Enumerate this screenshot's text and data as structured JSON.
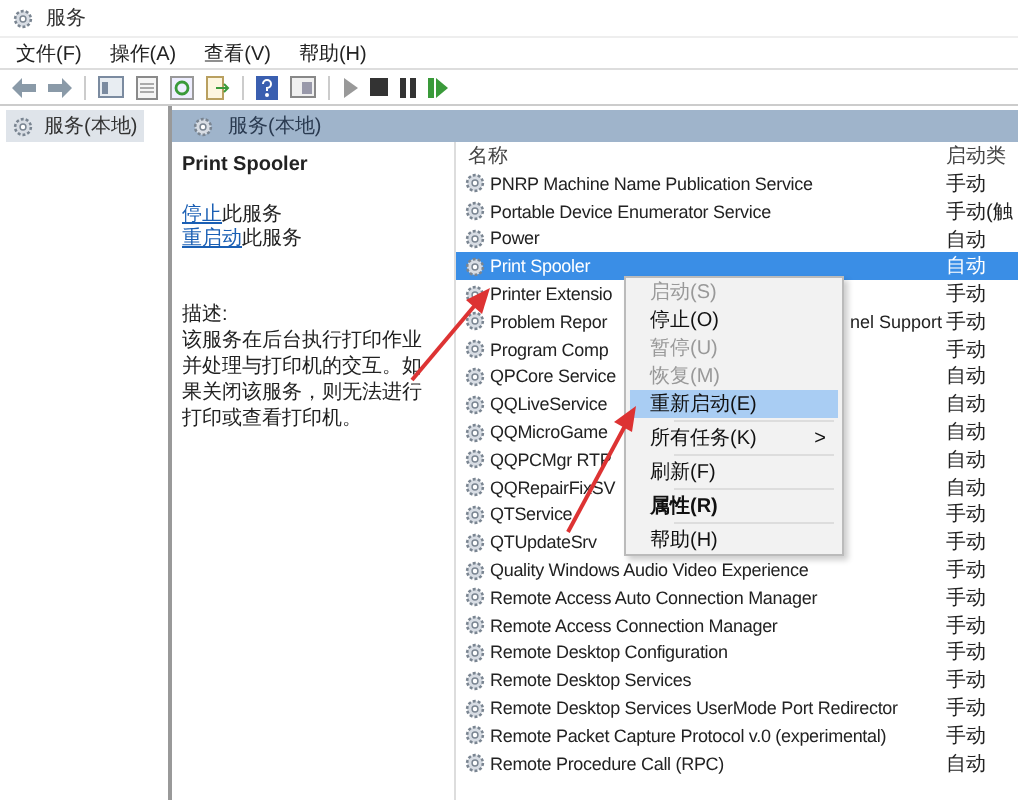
{
  "window": {
    "title": "服务"
  },
  "menu_bar": [
    "文件(F)",
    "操作(A)",
    "查看(V)",
    "帮助(H)"
  ],
  "tree": {
    "items": [
      {
        "label": "服务(本地)",
        "selected": true
      }
    ]
  },
  "panel_header": "服务(本地)",
  "details": {
    "service_name": "Print Spooler",
    "links": [
      {
        "link": "停止",
        "rest": "此服务"
      },
      {
        "link": "重启动",
        "rest": "此服务"
      }
    ],
    "description_label": "描述:",
    "description": "该服务在后台执行打印作业并处理与打印机的交互。如果关闭该服务，则无法进行打印或查看打印机。"
  },
  "table": {
    "columns": [
      "名称",
      "启动类"
    ],
    "rows": [
      {
        "name": "PNRP Machine Name Publication Service",
        "startup": "手动",
        "selected": false
      },
      {
        "name": "Portable Device Enumerator Service",
        "startup": "手动(触",
        "selected": false
      },
      {
        "name": "Power",
        "startup": "自动",
        "selected": false
      },
      {
        "name": "Print Spooler",
        "startup": "自动",
        "selected": true
      },
      {
        "name": "Printer Extensio",
        "startup": "手动",
        "selected": false
      },
      {
        "name": "Problem Repor",
        "tail": "nel Support",
        "startup": "手动",
        "selected": false
      },
      {
        "name": "Program Comp",
        "startup": "手动",
        "selected": false
      },
      {
        "name": "QPCore Service",
        "startup": "自动",
        "selected": false
      },
      {
        "name": "QQLiveService",
        "startup": "自动",
        "selected": false
      },
      {
        "name": "QQMicroGame",
        "startup": "自动",
        "selected": false
      },
      {
        "name": "QQPCMgr RTP",
        "startup": "自动",
        "selected": false
      },
      {
        "name": "QQRepairFixSV",
        "startup": "自动",
        "selected": false
      },
      {
        "name": "QTService",
        "startup": "手动",
        "selected": false
      },
      {
        "name": "QTUpdateSrv",
        "startup": "手动",
        "selected": false
      },
      {
        "name": "Quality Windows Audio Video Experience",
        "startup": "手动",
        "selected": false
      },
      {
        "name": "Remote Access Auto Connection Manager",
        "startup": "手动",
        "selected": false
      },
      {
        "name": "Remote Access Connection Manager",
        "startup": "手动",
        "selected": false
      },
      {
        "name": "Remote Desktop Configuration",
        "startup": "手动",
        "selected": false
      },
      {
        "name": "Remote Desktop Services",
        "startup": "手动",
        "selected": false
      },
      {
        "name": "Remote Desktop Services UserMode Port Redirector",
        "startup": "手动",
        "selected": false
      },
      {
        "name": "Remote Packet Capture Protocol v.0 (experimental)",
        "startup": "手动",
        "selected": false
      },
      {
        "name": "Remote Procedure Call (RPC)",
        "startup": "自动",
        "selected": false
      }
    ]
  },
  "context_menu": [
    {
      "kind": "item",
      "label": "启动(S)",
      "disabled": true,
      "selected": false
    },
    {
      "kind": "item",
      "label": "停止(O)",
      "disabled": false,
      "selected": false
    },
    {
      "kind": "item",
      "label": "暂停(U)",
      "disabled": true,
      "selected": false
    },
    {
      "kind": "item",
      "label": "恢复(M)",
      "disabled": true,
      "selected": false
    },
    {
      "kind": "item",
      "label": "重新启动(E)",
      "disabled": false,
      "selected": true
    },
    {
      "kind": "separator"
    },
    {
      "kind": "submenu",
      "label": "所有任务(K)",
      "arrow": ">",
      "disabled": false,
      "selected": false
    },
    {
      "kind": "separator"
    },
    {
      "kind": "item",
      "label": "刷新(F)",
      "disabled": false,
      "selected": false
    },
    {
      "kind": "separator"
    },
    {
      "kind": "default",
      "label": "属性(R)",
      "disabled": false,
      "selected": false
    },
    {
      "kind": "separator"
    },
    {
      "kind": "item",
      "label": "帮助(H)",
      "disabled": false,
      "selected": false
    }
  ]
}
